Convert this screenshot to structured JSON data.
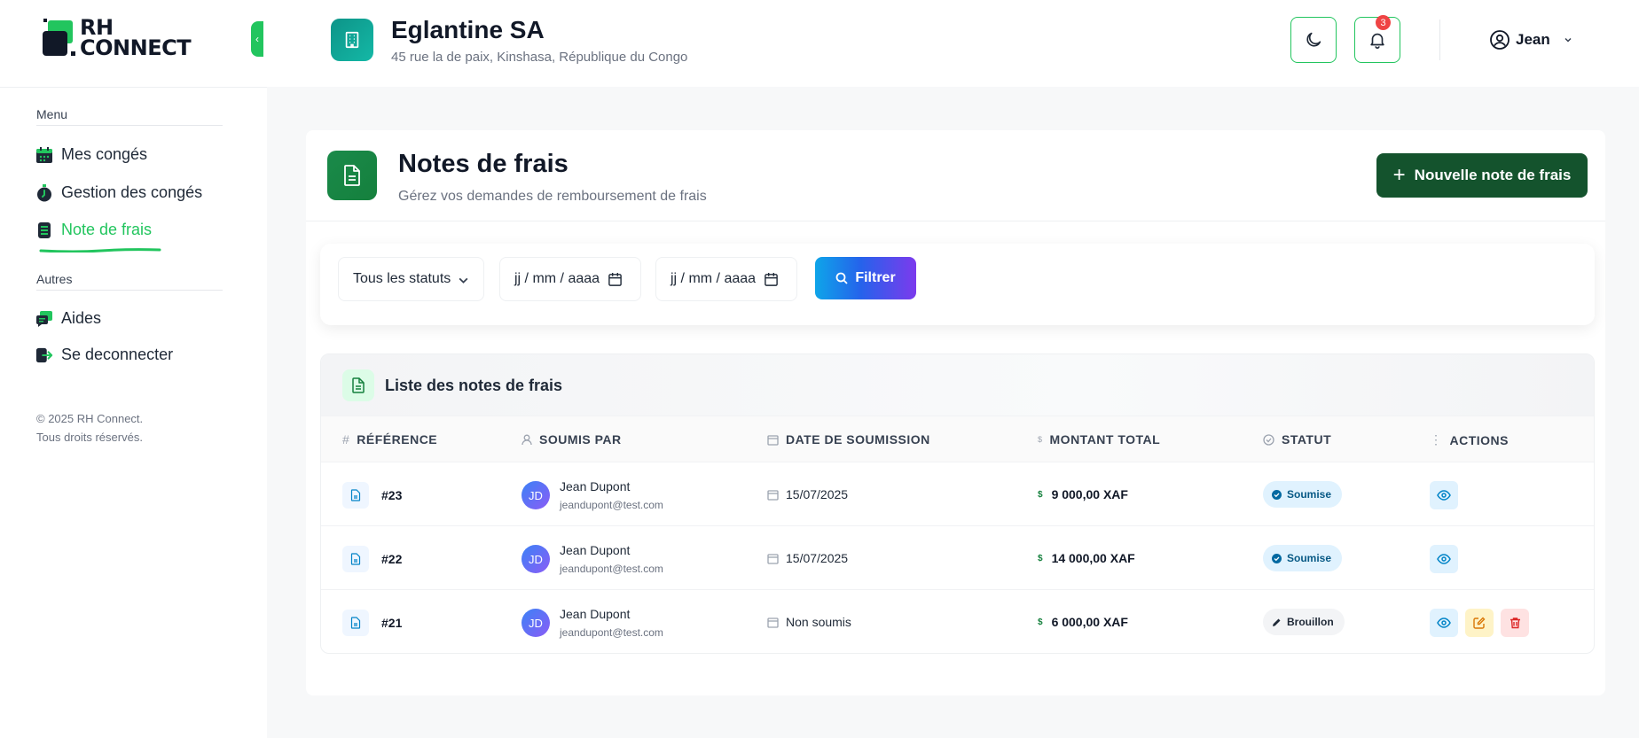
{
  "brand": {
    "line1": "RH",
    "line2": "CONNECT"
  },
  "sidebar": {
    "menu_label": "Menu",
    "items": [
      {
        "label": "Mes congés",
        "icon": "calendar-icon"
      },
      {
        "label": "Gestion des congés",
        "icon": "stopwatch-icon"
      },
      {
        "label": "Note de frais",
        "icon": "receipt-icon",
        "active": true
      }
    ],
    "other_label": "Autres",
    "other_items": [
      {
        "label": "Aides",
        "icon": "chat-icon"
      },
      {
        "label": "Se deconnecter",
        "icon": "logout-icon"
      }
    ],
    "copyright_line1": "© 2025 RH Connect.",
    "copyright_line2": "Tous droits réservés."
  },
  "header": {
    "company_name": "Eglantine SA",
    "company_address": "45 rue la de paix, Kinshasa, République du Congo",
    "notification_count": "3",
    "user_name": "Jean"
  },
  "page": {
    "title": "Notes de frais",
    "subtitle": "Gérez vos demandes de remboursement de frais",
    "new_button": "Nouvelle note de frais",
    "new_button_icon": "+"
  },
  "filters": {
    "status_value": "Tous les statuts",
    "date_from": "jj / mm / aaaa",
    "date_to": "jj / mm / aaaa",
    "filter_button": "Filtrer"
  },
  "list": {
    "title": "Liste des notes de frais",
    "columns": {
      "reference": "RÉFÉRENCE",
      "submitted_by": "SOUMIS PAR",
      "date": "DATE DE SOUMISSION",
      "amount": "MONTANT TOTAL",
      "status": "STATUT",
      "actions": "ACTIONS"
    },
    "rows": [
      {
        "ref": "#23",
        "initials": "JD",
        "name": "Jean Dupont",
        "email": "jeandupont@test.com",
        "date": "15/07/2025",
        "amount": "9 000,00 XAF",
        "status": "Soumise"
      },
      {
        "ref": "#22",
        "initials": "JD",
        "name": "Jean Dupont",
        "email": "jeandupont@test.com",
        "date": "15/07/2025",
        "amount": "14 000,00 XAF",
        "status": "Soumise"
      },
      {
        "ref": "#21",
        "initials": "JD",
        "name": "Jean Dupont",
        "email": "jeandupont@test.com",
        "date": "Non soumis",
        "amount": "6 000,00 XAF",
        "status": "Brouillon"
      }
    ]
  },
  "colors": {
    "accent": "#22c55e",
    "primary_dark": "#14532d",
    "status_submitted": "#0369a1"
  }
}
